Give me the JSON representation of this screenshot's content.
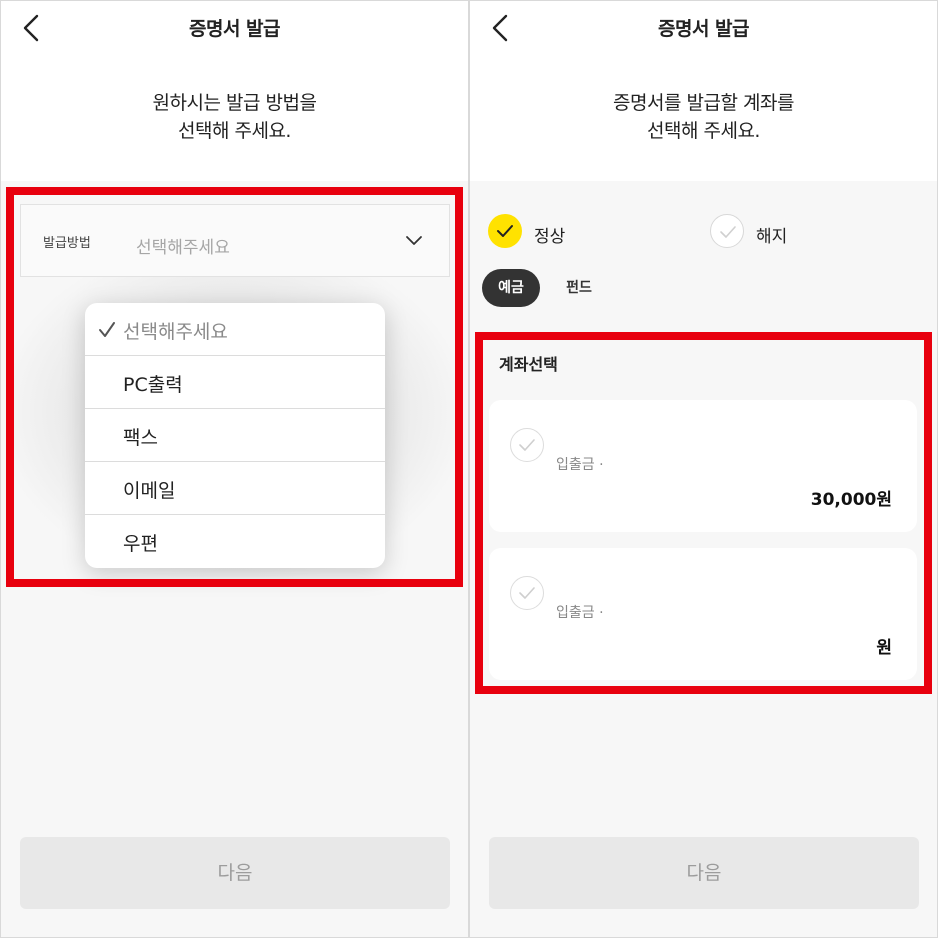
{
  "left": {
    "title": "증명서 발급",
    "instruction": [
      "원하시는 발급 방법을",
      "선택해 주세요."
    ],
    "field": {
      "label": "발급방법",
      "placeholder": "선택해주세요"
    },
    "dropdown": {
      "selected_index": 0,
      "options": [
        "선택해주세요",
        "PC출력",
        "팩스",
        "이메일",
        "우편"
      ]
    },
    "next_label": "다음"
  },
  "right": {
    "title": "증명서 발급",
    "instruction": [
      "증명서를 발급할 계좌를",
      "선택해 주세요."
    ],
    "status_options": [
      {
        "label": "정상",
        "selected": true
      },
      {
        "label": "해지",
        "selected": false
      }
    ],
    "tabs": [
      {
        "label": "예금",
        "active": true
      },
      {
        "label": "펀드",
        "active": false
      }
    ],
    "section_title": "계좌선택",
    "accounts": [
      {
        "label": "입출금 ·",
        "amount": "30,000원"
      },
      {
        "label": "입출금 ·",
        "amount": "원"
      }
    ],
    "next_label": "다음"
  },
  "colors": {
    "highlight_border": "#e8000e",
    "selected_radio": "#ffe200",
    "active_chip": "#333333",
    "disabled_button": "#e8e8e8"
  },
  "icons": [
    "back-arrow-icon",
    "chevron-down-icon",
    "checkmark-icon",
    "check-circle-icon"
  ]
}
